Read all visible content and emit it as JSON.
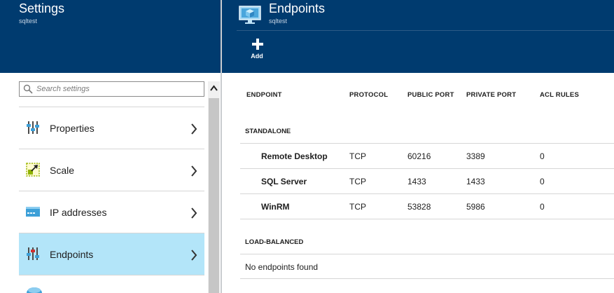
{
  "settings_blade": {
    "title": "Settings",
    "subtitle": "sqltest",
    "search": {
      "placeholder": "Search settings"
    },
    "items": [
      {
        "label": "Properties",
        "icon": "properties-icon"
      },
      {
        "label": "Scale",
        "icon": "scale-icon"
      },
      {
        "label": "IP addresses",
        "icon": "ip-addresses-icon"
      },
      {
        "label": "Endpoints",
        "icon": "endpoints-icon",
        "active": true
      }
    ]
  },
  "endpoints_blade": {
    "title": "Endpoints",
    "subtitle": "sqltest",
    "toolbar": {
      "add_label": "Add"
    },
    "columns": [
      "ENDPOINT",
      "PROTOCOL",
      "PUBLIC PORT",
      "PRIVATE PORT",
      "ACL RULES"
    ],
    "groups": {
      "standalone": {
        "label": "STANDALONE",
        "rows": [
          {
            "endpoint": "Remote Desktop",
            "protocol": "TCP",
            "public_port": "60216",
            "private_port": "3389",
            "acl_rules": "0"
          },
          {
            "endpoint": "SQL Server",
            "protocol": "TCP",
            "public_port": "1433",
            "private_port": "1433",
            "acl_rules": "0"
          },
          {
            "endpoint": "WinRM",
            "protocol": "TCP",
            "public_port": "53828",
            "private_port": "5986",
            "acl_rules": "0"
          }
        ]
      },
      "load_balanced": {
        "label": "LOAD-BALANCED",
        "empty_text": "No endpoints found"
      }
    }
  },
  "colors": {
    "header_bg": "#003b6f",
    "active_item_bg": "#b3e5f9",
    "divider": "#d6d6d6"
  }
}
